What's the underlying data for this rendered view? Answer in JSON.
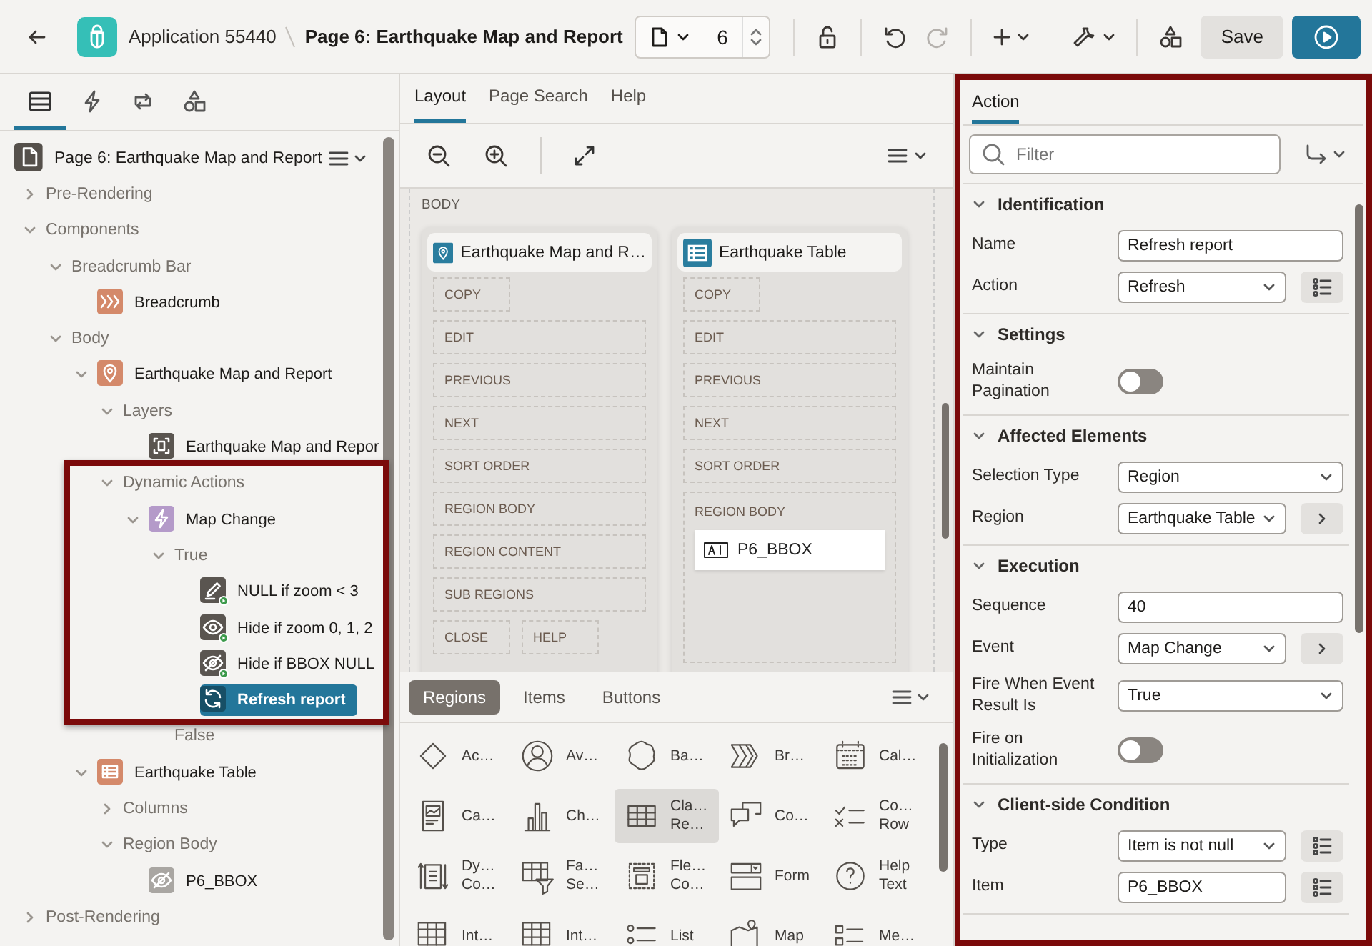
{
  "header": {
    "app_name": "Application 55440",
    "page_title": "Page 6: Earthquake Map and Report",
    "page_number": "6",
    "redo_disabled": true,
    "save_label": "Save"
  },
  "left_panel": {
    "tabs": [
      {
        "kind": "rendering",
        "selected": true
      },
      {
        "kind": "dynamic-actions",
        "selected": false
      },
      {
        "kind": "processing",
        "selected": false
      },
      {
        "kind": "shared",
        "selected": false
      }
    ],
    "tree": [
      {
        "label": "Page 6: Earthquake Map and Report",
        "kind": "page",
        "selected": false,
        "children": [
          {
            "label": "Pre-Rendering",
            "expanded": false,
            "selected": false
          },
          {
            "label": "Components",
            "expanded": true,
            "selected": false,
            "children": [
              {
                "label": "Breadcrumb Bar",
                "expanded": true,
                "selected": false,
                "children": [
                  {
                    "label": "Breadcrumb",
                    "kind": "breadcrumb",
                    "selected": false
                  }
                ]
              },
              {
                "label": "Body",
                "expanded": true,
                "selected": false,
                "children": [
                  {
                    "label": "Earthquake Map and Report",
                    "kind": "map",
                    "expanded": true,
                    "selected": false,
                    "children": [
                      {
                        "label": "Layers",
                        "expanded": true,
                        "selected": false,
                        "children": [
                          {
                            "label": "Earthquake Map and Repor",
                            "kind": "layer",
                            "selected": false
                          }
                        ]
                      },
                      {
                        "label": "Dynamic Actions",
                        "expanded": true,
                        "selected": false,
                        "children": [
                          {
                            "label": "Map Change",
                            "kind": "dynamic-action",
                            "expanded": true,
                            "selected": false,
                            "children": [
                              {
                                "label": "True",
                                "expanded": true,
                                "selected": false,
                                "children": [
                                  {
                                    "label": "NULL if zoom < 3",
                                    "kind": "set-value",
                                    "selected": false
                                  },
                                  {
                                    "label": "Hide if zoom 0, 1, 2",
                                    "kind": "show",
                                    "selected": false
                                  },
                                  {
                                    "label": "Hide if BBOX NULL",
                                    "kind": "hide",
                                    "selected": false
                                  },
                                  {
                                    "label": "Refresh report",
                                    "kind": "refresh",
                                    "selected": true
                                  }
                                ]
                              },
                              {
                                "label": "False",
                                "selected": false
                              }
                            ]
                          }
                        ]
                      }
                    ]
                  },
                  {
                    "label": "Earthquake Table",
                    "kind": "table",
                    "expanded": true,
                    "selected": false,
                    "children": [
                      {
                        "label": "Columns",
                        "expanded": false,
                        "selected": false
                      },
                      {
                        "label": "Region Body",
                        "expanded": true,
                        "selected": false,
                        "children": [
                          {
                            "label": "P6_BBOX",
                            "kind": "hidden-item",
                            "selected": false
                          }
                        ]
                      }
                    ]
                  }
                ]
              }
            ]
          },
          {
            "label": "Post-Rendering",
            "expanded": false,
            "selected": false
          }
        ]
      }
    ]
  },
  "layout_panel": {
    "tabs": [
      {
        "label": "Layout",
        "selected": true
      },
      {
        "label": "Page Search",
        "selected": false
      },
      {
        "label": "Help",
        "selected": false
      }
    ],
    "canvas": {
      "label": "BODY",
      "regions": [
        {
          "title": "Earthquake Map and R…",
          "kind": "map",
          "slots": [
            {
              "label": "COPY",
              "kind": "narrow"
            },
            {
              "label": "EDIT",
              "kind": "wide"
            },
            {
              "label": "PREVIOUS",
              "kind": "wide"
            },
            {
              "label": "NEXT",
              "kind": "wide"
            },
            {
              "label": "SORT ORDER",
              "kind": "wide"
            },
            {
              "label": "REGION BODY",
              "kind": "wide"
            },
            {
              "label": "REGION CONTENT",
              "kind": "wide"
            },
            {
              "label": "SUB REGIONS",
              "kind": "wide"
            },
            {
              "label": "CLOSE",
              "kind": "narrow"
            },
            {
              "label": "HELP",
              "kind": "narrow"
            }
          ]
        },
        {
          "title": "Earthquake Table",
          "kind": "table",
          "slots": [
            {
              "label": "COPY",
              "kind": "narrow"
            },
            {
              "label": "EDIT",
              "kind": "wide"
            },
            {
              "label": "PREVIOUS",
              "kind": "wide"
            },
            {
              "label": "NEXT",
              "kind": "wide"
            },
            {
              "label": "SORT ORDER",
              "kind": "wide"
            },
            {
              "label": "REGION BODY",
              "kind": "wide",
              "items": [
                {
                  "label": "P6_BBOX"
                }
              ]
            }
          ]
        }
      ]
    }
  },
  "gallery": {
    "tabs": [
      {
        "label": "Regions",
        "selected": true
      },
      {
        "label": "Items",
        "selected": false
      },
      {
        "label": "Buttons",
        "selected": false
      }
    ],
    "items": [
      {
        "lines": [
          "Ac…"
        ],
        "kind": "diamond",
        "selected": false
      },
      {
        "lines": [
          "Av…"
        ],
        "kind": "avatar",
        "selected": false
      },
      {
        "lines": [
          "Ba…"
        ],
        "kind": "badge",
        "selected": false
      },
      {
        "lines": [
          "Br…"
        ],
        "kind": "breadcrumb",
        "selected": false
      },
      {
        "lines": [
          "Cal…"
        ],
        "kind": "calendar",
        "selected": false
      },
      {
        "lines": [
          "Ca…"
        ],
        "kind": "card",
        "selected": false
      },
      {
        "lines": [
          "Ch…"
        ],
        "kind": "chart",
        "selected": false
      },
      {
        "lines": [
          "Cla…",
          "Re…"
        ],
        "kind": "table",
        "selected": true
      },
      {
        "lines": [
          "Co…"
        ],
        "kind": "comments",
        "selected": false
      },
      {
        "lines": [
          "Co…",
          "Row"
        ],
        "kind": "checklist",
        "selected": false
      },
      {
        "lines": [
          "Dy…",
          "Co…"
        ],
        "kind": "dynamic",
        "selected": false
      },
      {
        "lines": [
          "Fa…",
          "Se…"
        ],
        "kind": "facet",
        "selected": false
      },
      {
        "lines": [
          "Fle…",
          "Co…"
        ],
        "kind": "flex",
        "selected": false
      },
      {
        "lines": [
          "Form"
        ],
        "kind": "form",
        "selected": false
      },
      {
        "lines": [
          "Help",
          "Text"
        ],
        "kind": "help",
        "selected": false
      },
      {
        "lines": [
          "Int…"
        ],
        "kind": "grid",
        "selected": false
      },
      {
        "lines": [
          "Int…"
        ],
        "kind": "grid",
        "selected": false
      },
      {
        "lines": [
          "List"
        ],
        "kind": "list",
        "selected": false
      },
      {
        "lines": [
          "Map"
        ],
        "kind": "map",
        "selected": false
      },
      {
        "lines": [
          "Me…"
        ],
        "kind": "menu",
        "selected": false
      }
    ]
  },
  "property_panel": {
    "tabs": [
      {
        "label": "Action",
        "selected": true
      }
    ],
    "filter": {
      "placeholder": "Filter"
    },
    "sections": [
      {
        "title": "Identification",
        "expanded": true,
        "properties": [
          {
            "label": "Name",
            "kind": "text",
            "value": "Refresh report"
          },
          {
            "label": "Action",
            "kind": "select",
            "value": "Refresh",
            "button": {
              "kind": "list"
            }
          }
        ]
      },
      {
        "title": "Settings",
        "expanded": true,
        "properties": [
          {
            "label": "Maintain Pagination",
            "kind": "switch",
            "on": false
          }
        ]
      },
      {
        "title": "Affected Elements",
        "expanded": true,
        "properties": [
          {
            "label": "Selection Type",
            "kind": "select",
            "value": "Region"
          },
          {
            "label": "Region",
            "kind": "select",
            "value": "Earthquake Table",
            "button": {
              "kind": "arrow"
            }
          }
        ]
      },
      {
        "title": "Execution",
        "expanded": true,
        "properties": [
          {
            "label": "Sequence",
            "kind": "text",
            "value": "40"
          },
          {
            "label": "Event",
            "kind": "select",
            "value": "Map Change",
            "button": {
              "kind": "arrow"
            }
          },
          {
            "label": "Fire When Event Result Is",
            "kind": "select",
            "value": "True"
          },
          {
            "label": "Fire on Initialization",
            "kind": "switch",
            "on": false
          }
        ]
      },
      {
        "title": "Client-side Condition",
        "expanded": true,
        "properties": [
          {
            "label": "Type",
            "kind": "select",
            "value": "Item is not null",
            "button": {
              "kind": "list"
            }
          },
          {
            "label": "Item",
            "kind": "text",
            "value": "P6_BBOX",
            "button": {
              "kind": "list"
            }
          }
        ]
      }
    ]
  }
}
